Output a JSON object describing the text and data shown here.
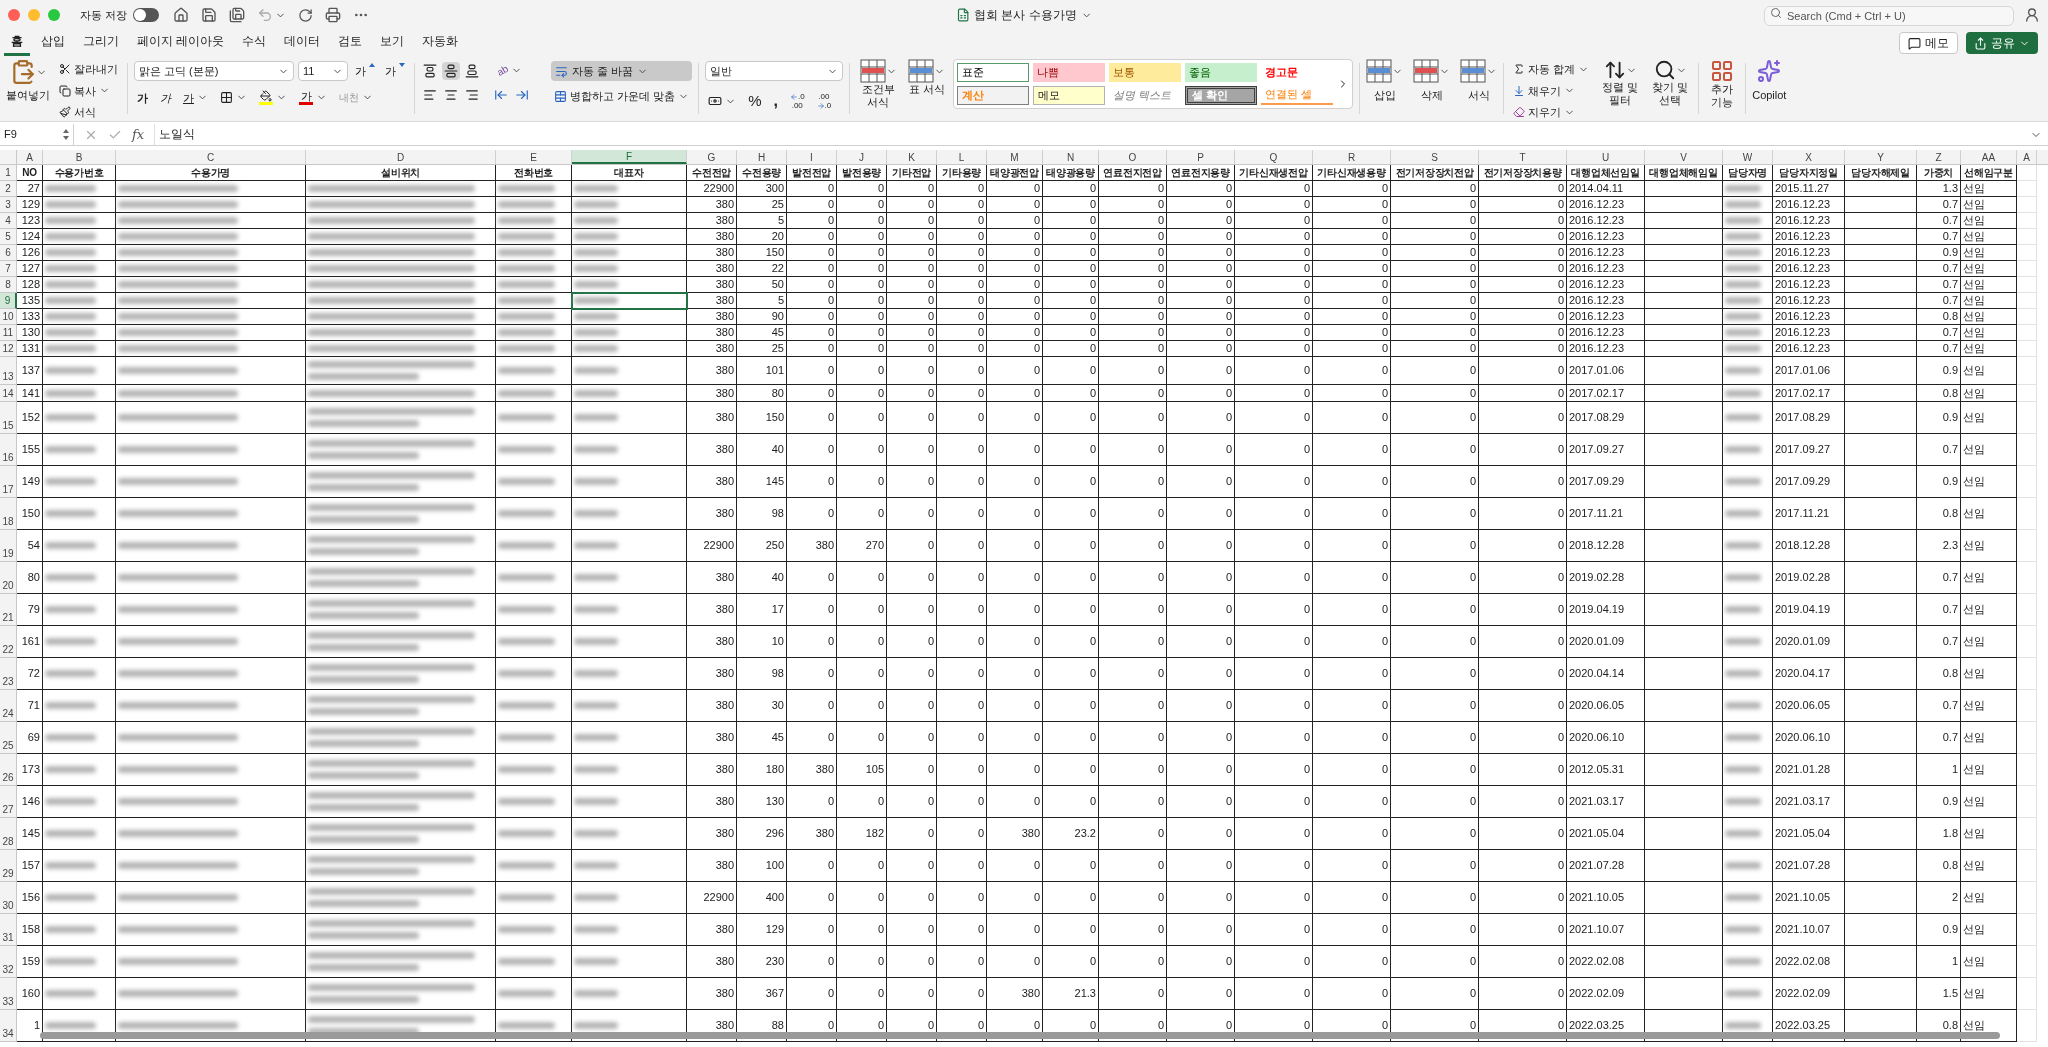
{
  "window": {
    "title": "협회 본사 수용가명",
    "autosave_label": "자동 저장",
    "autosave_on": false,
    "search_placeholder": "Search (Cmd + Ctrl + U)"
  },
  "tabs": [
    {
      "label": "홈",
      "selected": true
    },
    {
      "label": "삽입",
      "selected": false
    },
    {
      "label": "그리기",
      "selected": false
    },
    {
      "label": "페이지 레이아웃",
      "selected": false
    },
    {
      "label": "수식",
      "selected": false
    },
    {
      "label": "데이터",
      "selected": false
    },
    {
      "label": "검토",
      "selected": false
    },
    {
      "label": "보기",
      "selected": false
    },
    {
      "label": "자동화",
      "selected": false
    }
  ],
  "top_buttons": {
    "comments": "메모",
    "share": "공유"
  },
  "ribbon": {
    "clipboard": {
      "paste": "붙여넣기",
      "cut": "잘라내기",
      "copy": "복사",
      "format_painter": "서식"
    },
    "font": {
      "name": "맑은 고딕 (본문)",
      "size": "11",
      "grow": "가",
      "shrink": "가",
      "bold": "가",
      "italic": "가",
      "underline": "가",
      "font_color": "가",
      "phonetic": "내천"
    },
    "alignment": {
      "middle_align_on": true,
      "orientation": "ab",
      "wrap_text": "자동 줄 바꿈",
      "wrap_text_on": true,
      "merge": "병합하고 가운데 맞춤"
    },
    "number": {
      "format": "일반",
      "percent": "%",
      "comma": ",",
      "decimal_buttons": [
        {
          "top": ".0",
          "bottom": ".00"
        },
        {
          "top": ".00",
          "bottom": ".0"
        }
      ]
    },
    "styles": {
      "conditional": "조건부 서식",
      "table": "표 서식",
      "cell_styles": [
        {
          "label": "표준",
          "kind": "normal"
        },
        {
          "label": "나쁨",
          "kind": "bad"
        },
        {
          "label": "보통",
          "kind": "neutral"
        },
        {
          "label": "좋음",
          "kind": "good"
        },
        {
          "label": "경고문",
          "kind": "warning"
        },
        {
          "label": "계산",
          "kind": "calc"
        },
        {
          "label": "메모",
          "kind": "note"
        },
        {
          "label": "설명 텍스트",
          "kind": "explanatory"
        },
        {
          "label": "셀 확인",
          "kind": "check"
        },
        {
          "label": "연결된 셀",
          "kind": "linked"
        }
      ]
    },
    "cells": [
      "삽입",
      "삭제",
      "서식"
    ],
    "editing": {
      "autosum": "자동 합계",
      "fill": "채우기",
      "clear": "지우기",
      "sort": "정렬 및 필터",
      "find": "찾기 및 선택"
    },
    "addins": "추가 기능",
    "copilot": "Copilot"
  },
  "formula_bar": {
    "name_box": "F9",
    "fx": "fx",
    "value": "노일식"
  },
  "sheet": {
    "columns": [
      {
        "letter": "A",
        "selected": false
      },
      {
        "letter": "B",
        "selected": false
      },
      {
        "letter": "C",
        "selected": false
      },
      {
        "letter": "D",
        "selected": false
      },
      {
        "letter": "E",
        "selected": false
      },
      {
        "letter": "F",
        "selected": true
      },
      {
        "letter": "G",
        "selected": false
      },
      {
        "letter": "H",
        "selected": false
      },
      {
        "letter": "I",
        "selected": false
      },
      {
        "letter": "J",
        "selected": false
      },
      {
        "letter": "K",
        "selected": false
      },
      {
        "letter": "L",
        "selected": false
      },
      {
        "letter": "M",
        "selected": false
      },
      {
        "letter": "N",
        "selected": false
      },
      {
        "letter": "O",
        "selected": false
      },
      {
        "letter": "P",
        "selected": false
      },
      {
        "letter": "Q",
        "selected": false
      },
      {
        "letter": "R",
        "selected": false
      },
      {
        "letter": "S",
        "selected": false
      },
      {
        "letter": "T",
        "selected": false
      },
      {
        "letter": "U",
        "selected": false
      },
      {
        "letter": "V",
        "selected": false
      },
      {
        "letter": "W",
        "selected": false
      },
      {
        "letter": "X",
        "selected": false
      },
      {
        "letter": "Y",
        "selected": false
      },
      {
        "letter": "Z",
        "selected": false
      },
      {
        "letter": "AA",
        "selected": false
      },
      {
        "letter": "A",
        "selected": false
      }
    ],
    "header_row": {
      "number": "1",
      "cells": [
        "NO",
        "수용가번호",
        "수용가명",
        "설비위치",
        "전화번호",
        "대표자",
        "수전전압",
        "수전용량",
        "발전전압",
        "발전용량",
        "기타전압",
        "기타용량",
        "태양광전압",
        "태양광용량",
        "연료전지전압",
        "연료전지용량",
        "기타신재생전압",
        "기타신재생용량",
        "전기저장장치전압",
        "전기저장장치용량",
        "대행업체선임일",
        "대행업체해임일",
        "담당자명",
        "담당자지정일",
        "담당자해제일",
        "가중치",
        "선해임구분"
      ]
    },
    "rows": [
      {
        "number": "2",
        "selected": false,
        "no": "27",
        "values": [
          "22900",
          "300",
          "0",
          "0",
          "0",
          "0",
          "0",
          "0",
          "0",
          "0",
          "0",
          "0",
          "0",
          "0"
        ],
        "agency_start": "2014.04.11",
        "manager_start": "2015.11.27",
        "weight": "1.3",
        "appointment": "선임"
      },
      {
        "number": "3",
        "selected": false,
        "no": "129",
        "values": [
          "380",
          "25",
          "0",
          "0",
          "0",
          "0",
          "0",
          "0",
          "0",
          "0",
          "0",
          "0",
          "0",
          "0"
        ],
        "agency_start": "2016.12.23",
        "manager_start": "2016.12.23",
        "weight": "0.7",
        "appointment": "선임"
      },
      {
        "number": "4",
        "selected": false,
        "no": "123",
        "values": [
          "380",
          "5",
          "0",
          "0",
          "0",
          "0",
          "0",
          "0",
          "0",
          "0",
          "0",
          "0",
          "0",
          "0"
        ],
        "agency_start": "2016.12.23",
        "manager_start": "2016.12.23",
        "weight": "0.7",
        "appointment": "선임"
      },
      {
        "number": "5",
        "selected": false,
        "no": "124",
        "values": [
          "380",
          "20",
          "0",
          "0",
          "0",
          "0",
          "0",
          "0",
          "0",
          "0",
          "0",
          "0",
          "0",
          "0"
        ],
        "agency_start": "2016.12.23",
        "manager_start": "2016.12.23",
        "weight": "0.7",
        "appointment": "선임"
      },
      {
        "number": "6",
        "selected": false,
        "no": "126",
        "values": [
          "380",
          "150",
          "0",
          "0",
          "0",
          "0",
          "0",
          "0",
          "0",
          "0",
          "0",
          "0",
          "0",
          "0"
        ],
        "agency_start": "2016.12.23",
        "manager_start": "2016.12.23",
        "weight": "0.9",
        "appointment": "선임"
      },
      {
        "number": "7",
        "selected": false,
        "no": "127",
        "values": [
          "380",
          "22",
          "0",
          "0",
          "0",
          "0",
          "0",
          "0",
          "0",
          "0",
          "0",
          "0",
          "0",
          "0"
        ],
        "agency_start": "2016.12.23",
        "manager_start": "2016.12.23",
        "weight": "0.7",
        "appointment": "선임"
      },
      {
        "number": "8",
        "selected": false,
        "no": "128",
        "values": [
          "380",
          "50",
          "0",
          "0",
          "0",
          "0",
          "0",
          "0",
          "0",
          "0",
          "0",
          "0",
          "0",
          "0"
        ],
        "agency_start": "2016.12.23",
        "manager_start": "2016.12.23",
        "weight": "0.7",
        "appointment": "선임"
      },
      {
        "number": "9",
        "selected": true,
        "no": "135",
        "values": [
          "380",
          "5",
          "0",
          "0",
          "0",
          "0",
          "0",
          "0",
          "0",
          "0",
          "0",
          "0",
          "0",
          "0"
        ],
        "agency_start": "2016.12.23",
        "manager_start": "2016.12.23",
        "weight": "0.7",
        "appointment": "선임"
      },
      {
        "number": "10",
        "selected": false,
        "no": "133",
        "values": [
          "380",
          "90",
          "0",
          "0",
          "0",
          "0",
          "0",
          "0",
          "0",
          "0",
          "0",
          "0",
          "0",
          "0"
        ],
        "agency_start": "2016.12.23",
        "manager_start": "2016.12.23",
        "weight": "0.8",
        "appointment": "선임"
      },
      {
        "number": "11",
        "selected": false,
        "no": "130",
        "values": [
          "380",
          "45",
          "0",
          "0",
          "0",
          "0",
          "0",
          "0",
          "0",
          "0",
          "0",
          "0",
          "0",
          "0"
        ],
        "agency_start": "2016.12.23",
        "manager_start": "2016.12.23",
        "weight": "0.7",
        "appointment": "선임"
      },
      {
        "number": "12",
        "selected": false,
        "no": "131",
        "values": [
          "380",
          "25",
          "0",
          "0",
          "0",
          "0",
          "0",
          "0",
          "0",
          "0",
          "0",
          "0",
          "0",
          "0"
        ],
        "agency_start": "2016.12.23",
        "manager_start": "2016.12.23",
        "weight": "0.7",
        "appointment": "선임"
      },
      {
        "number": "13",
        "selected": false,
        "no": "137",
        "values": [
          "380",
          "101",
          "0",
          "0",
          "0",
          "0",
          "0",
          "0",
          "0",
          "0",
          "0",
          "0",
          "0",
          "0"
        ],
        "agency_start": "2017.01.06",
        "manager_start": "2017.01.06",
        "weight": "0.9",
        "appointment": "선임"
      },
      {
        "number": "14",
        "selected": false,
        "no": "141",
        "values": [
          "380",
          "80",
          "0",
          "0",
          "0",
          "0",
          "0",
          "0",
          "0",
          "0",
          "0",
          "0",
          "0",
          "0"
        ],
        "agency_start": "2017.02.17",
        "manager_start": "2017.02.17",
        "weight": "0.8",
        "appointment": "선임"
      },
      {
        "number": "15",
        "selected": false,
        "no": "152",
        "values": [
          "380",
          "150",
          "0",
          "0",
          "0",
          "0",
          "0",
          "0",
          "0",
          "0",
          "0",
          "0",
          "0",
          "0"
        ],
        "agency_start": "2017.08.29",
        "manager_start": "2017.08.29",
        "weight": "0.9",
        "appointment": "선임"
      },
      {
        "number": "16",
        "selected": false,
        "no": "155",
        "values": [
          "380",
          "40",
          "0",
          "0",
          "0",
          "0",
          "0",
          "0",
          "0",
          "0",
          "0",
          "0",
          "0",
          "0"
        ],
        "agency_start": "2017.09.27",
        "manager_start": "2017.09.27",
        "weight": "0.7",
        "appointment": "선임"
      },
      {
        "number": "17",
        "selected": false,
        "no": "149",
        "values": [
          "380",
          "145",
          "0",
          "0",
          "0",
          "0",
          "0",
          "0",
          "0",
          "0",
          "0",
          "0",
          "0",
          "0"
        ],
        "agency_start": "2017.09.29",
        "manager_start": "2017.09.29",
        "weight": "0.9",
        "appointment": "선임"
      },
      {
        "number": "18",
        "selected": false,
        "no": "150",
        "values": [
          "380",
          "98",
          "0",
          "0",
          "0",
          "0",
          "0",
          "0",
          "0",
          "0",
          "0",
          "0",
          "0",
          "0"
        ],
        "agency_start": "2017.11.21",
        "manager_start": "2017.11.21",
        "weight": "0.8",
        "appointment": "선임"
      },
      {
        "number": "19",
        "selected": false,
        "no": "54",
        "values": [
          "22900",
          "250",
          "380",
          "270",
          "0",
          "0",
          "0",
          "0",
          "0",
          "0",
          "0",
          "0",
          "0",
          "0"
        ],
        "agency_start": "2018.12.28",
        "manager_start": "2018.12.28",
        "weight": "2.3",
        "appointment": "선임"
      },
      {
        "number": "20",
        "selected": false,
        "no": "80",
        "values": [
          "380",
          "40",
          "0",
          "0",
          "0",
          "0",
          "0",
          "0",
          "0",
          "0",
          "0",
          "0",
          "0",
          "0"
        ],
        "agency_start": "2019.02.28",
        "manager_start": "2019.02.28",
        "weight": "0.7",
        "appointment": "선임"
      },
      {
        "number": "21",
        "selected": false,
        "no": "79",
        "values": [
          "380",
          "17",
          "0",
          "0",
          "0",
          "0",
          "0",
          "0",
          "0",
          "0",
          "0",
          "0",
          "0",
          "0"
        ],
        "agency_start": "2019.04.19",
        "manager_start": "2019.04.19",
        "weight": "0.7",
        "appointment": "선임"
      },
      {
        "number": "22",
        "selected": false,
        "no": "161",
        "values": [
          "380",
          "10",
          "0",
          "0",
          "0",
          "0",
          "0",
          "0",
          "0",
          "0",
          "0",
          "0",
          "0",
          "0"
        ],
        "agency_start": "2020.01.09",
        "manager_start": "2020.01.09",
        "weight": "0.7",
        "appointment": "선임"
      },
      {
        "number": "23",
        "selected": false,
        "no": "72",
        "values": [
          "380",
          "98",
          "0",
          "0",
          "0",
          "0",
          "0",
          "0",
          "0",
          "0",
          "0",
          "0",
          "0",
          "0"
        ],
        "agency_start": "2020.04.14",
        "manager_start": "2020.04.17",
        "weight": "0.8",
        "appointment": "선임"
      },
      {
        "number": "24",
        "selected": false,
        "no": "71",
        "values": [
          "380",
          "30",
          "0",
          "0",
          "0",
          "0",
          "0",
          "0",
          "0",
          "0",
          "0",
          "0",
          "0",
          "0"
        ],
        "agency_start": "2020.06.05",
        "manager_start": "2020.06.05",
        "weight": "0.7",
        "appointment": "선임"
      },
      {
        "number": "25",
        "selected": false,
        "no": "69",
        "values": [
          "380",
          "45",
          "0",
          "0",
          "0",
          "0",
          "0",
          "0",
          "0",
          "0",
          "0",
          "0",
          "0",
          "0"
        ],
        "agency_start": "2020.06.10",
        "manager_start": "2020.06.10",
        "weight": "0.7",
        "appointment": "선임"
      },
      {
        "number": "26",
        "selected": false,
        "no": "173",
        "values": [
          "380",
          "180",
          "380",
          "105",
          "0",
          "0",
          "0",
          "0",
          "0",
          "0",
          "0",
          "0",
          "0",
          "0"
        ],
        "agency_start": "2012.05.31",
        "manager_start": "2021.01.28",
        "weight": "1",
        "appointment": "선임"
      },
      {
        "number": "27",
        "selected": false,
        "no": "146",
        "values": [
          "380",
          "130",
          "0",
          "0",
          "0",
          "0",
          "0",
          "0",
          "0",
          "0",
          "0",
          "0",
          "0",
          "0"
        ],
        "agency_start": "2021.03.17",
        "manager_start": "2021.03.17",
        "weight": "0.9",
        "appointment": "선임"
      },
      {
        "number": "28",
        "selected": false,
        "no": "145",
        "values": [
          "380",
          "296",
          "380",
          "182",
          "0",
          "0",
          "380",
          "23.2",
          "0",
          "0",
          "0",
          "0",
          "0",
          "0"
        ],
        "agency_start": "2021.05.04",
        "manager_start": "2021.05.04",
        "weight": "1.8",
        "appointment": "선임"
      },
      {
        "number": "29",
        "selected": false,
        "no": "157",
        "values": [
          "380",
          "100",
          "0",
          "0",
          "0",
          "0",
          "0",
          "0",
          "0",
          "0",
          "0",
          "0",
          "0",
          "0"
        ],
        "agency_start": "2021.07.28",
        "manager_start": "2021.07.28",
        "weight": "0.8",
        "appointment": "선임"
      },
      {
        "number": "30",
        "selected": false,
        "no": "156",
        "values": [
          "22900",
          "400",
          "0",
          "0",
          "0",
          "0",
          "0",
          "0",
          "0",
          "0",
          "0",
          "0",
          "0",
          "0"
        ],
        "agency_start": "2021.10.05",
        "manager_start": "2021.10.05",
        "weight": "2",
        "appointment": "선임"
      },
      {
        "number": "31",
        "selected": false,
        "no": "158",
        "values": [
          "380",
          "129",
          "0",
          "0",
          "0",
          "0",
          "0",
          "0",
          "0",
          "0",
          "0",
          "0",
          "0",
          "0"
        ],
        "agency_start": "2021.10.07",
        "manager_start": "2021.10.07",
        "weight": "0.9",
        "appointment": "선임"
      },
      {
        "number": "32",
        "selected": false,
        "no": "159",
        "values": [
          "380",
          "230",
          "0",
          "0",
          "0",
          "0",
          "0",
          "0",
          "0",
          "0",
          "0",
          "0",
          "0",
          "0"
        ],
        "agency_start": "2022.02.08",
        "manager_start": "2022.02.08",
        "weight": "1",
        "appointment": "선임"
      },
      {
        "number": "33",
        "selected": false,
        "no": "160",
        "values": [
          "380",
          "367",
          "0",
          "0",
          "0",
          "0",
          "380",
          "21.3",
          "0",
          "0",
          "0",
          "0",
          "0",
          "0"
        ],
        "agency_start": "2022.02.09",
        "manager_start": "2022.02.09",
        "weight": "1.5",
        "appointment": "선임"
      },
      {
        "number": "34",
        "selected": false,
        "no": "1",
        "values": [
          "380",
          "88",
          "0",
          "0",
          "0",
          "0",
          "0",
          "0",
          "0",
          "0",
          "0",
          "0",
          "0",
          "0"
        ],
        "agency_start": "2022.03.25",
        "manager_start": "2022.03.25",
        "weight": "0.8",
        "appointment": "선임"
      }
    ]
  }
}
